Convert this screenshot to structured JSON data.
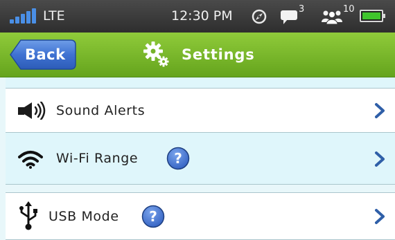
{
  "status_bar": {
    "network_label": "LTE",
    "time": "12:30 PM",
    "message_count": "3",
    "connected_users_count": "10",
    "signal_color": "#4a8fe6",
    "battery_color": "#3fc42c"
  },
  "header": {
    "back_label": "Back",
    "title": "Settings",
    "bar_color": "#7bbb2c",
    "back_button_color": "#3b6fd0"
  },
  "settings_items": [
    {
      "label": "Sound Alerts",
      "icon": "speaker-icon",
      "has_help": false
    },
    {
      "label": "Wi-Fi Range",
      "icon": "wifi-icon",
      "has_help": true
    },
    {
      "label": "USB Mode",
      "icon": "usb-icon",
      "has_help": true
    }
  ],
  "help_badge": {
    "symbol": "?",
    "color": "#3d6fd2"
  },
  "chevron_color": "#2f5fa8"
}
